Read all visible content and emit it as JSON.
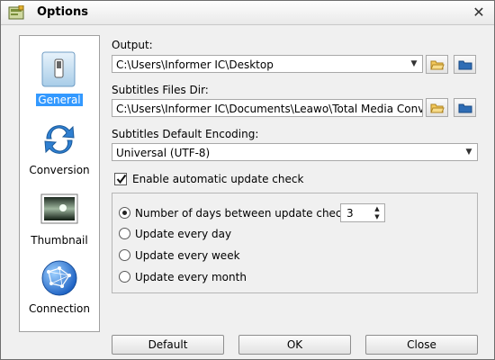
{
  "window": {
    "title": "Options",
    "close_icon": "close-icon",
    "app_icon": "settings-app-icon"
  },
  "sidebar": {
    "items": [
      {
        "label": "General",
        "icon": "switch-icon",
        "selected": true
      },
      {
        "label": "Conversion",
        "icon": "refresh-arrows-icon",
        "selected": false
      },
      {
        "label": "Thumbnail",
        "icon": "landscape-image-icon",
        "selected": false
      },
      {
        "label": "Connection",
        "icon": "globe-network-icon",
        "selected": false
      }
    ]
  },
  "output": {
    "label": "Output:",
    "value": "C:\\Users\\Informer IC\\Desktop"
  },
  "subtitles_dir": {
    "label": "Subtitles Files Dir:",
    "value": "C:\\Users\\Informer IC\\Documents\\Leawo\\Total Media Converter"
  },
  "encoding": {
    "label": "Subtitles Default Encoding:",
    "value": "Universal (UTF-8)"
  },
  "auto_update": {
    "label": "Enable automatic update check",
    "checked": true
  },
  "update_options": {
    "days_label": "Number of days between update checks",
    "days_value": "3",
    "daily_label": "Update every day",
    "weekly_label": "Update every week",
    "monthly_label": "Update every month",
    "selected": "days"
  },
  "buttons": {
    "default_label": "Default",
    "ok_label": "OK",
    "close_label": "Close"
  },
  "colors": {
    "selection": "#3399ff",
    "folder": "#f2c85b",
    "blue_folder": "#2f6db5"
  }
}
